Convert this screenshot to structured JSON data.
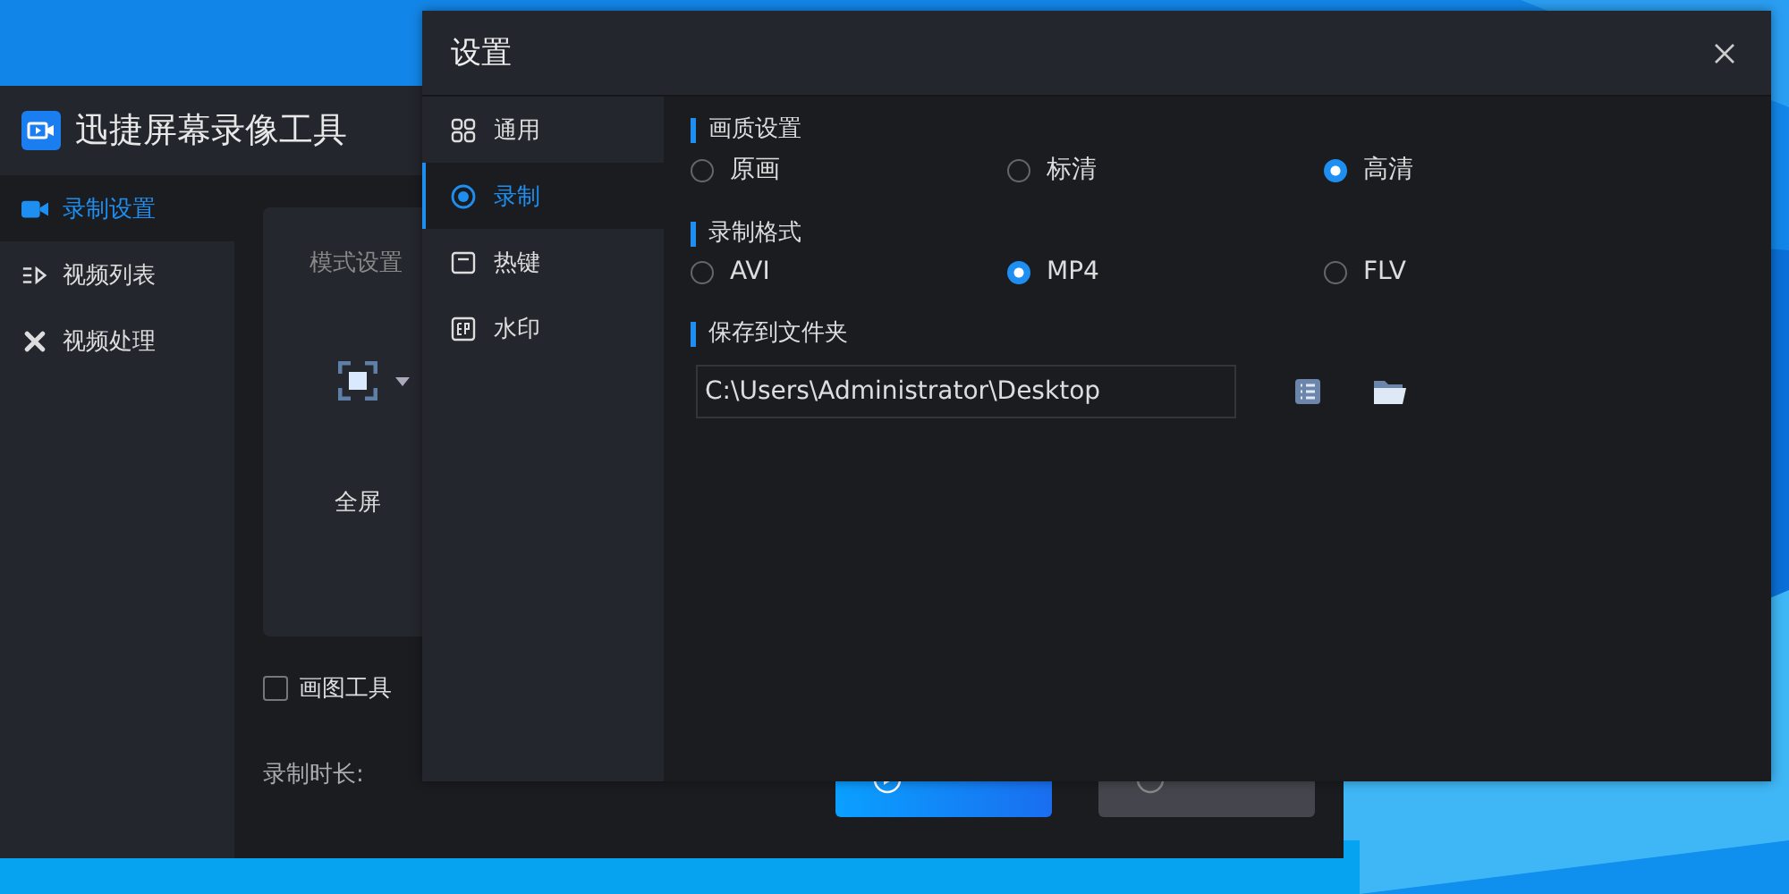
{
  "main_window": {
    "title": "迅捷屏幕录像工具",
    "sidebar": [
      {
        "label": "录制设置",
        "selected": true
      },
      {
        "label": "视频列表",
        "selected": false
      },
      {
        "label": "视频处理",
        "selected": false
      }
    ],
    "mode_card": {
      "title": "模式设置",
      "mode": "全屏"
    },
    "drawing_tool": {
      "label": "画图工具",
      "checked": false
    },
    "duration": {
      "label": "录制时长:"
    },
    "buttons": [
      {
        "kind": "primary"
      },
      {
        "kind": "disabled"
      }
    ]
  },
  "dialog": {
    "title": "设置",
    "nav": [
      {
        "label": "通用",
        "selected": false
      },
      {
        "label": "录制",
        "selected": true
      },
      {
        "label": "热键",
        "selected": false
      },
      {
        "label": "水印",
        "selected": false
      }
    ],
    "sections": [
      {
        "title": "画质设置",
        "kind": "radio",
        "options": [
          {
            "label": "原画",
            "selected": false
          },
          {
            "label": "标清",
            "selected": false
          },
          {
            "label": "高清",
            "selected": true
          }
        ]
      },
      {
        "title": "录制格式",
        "kind": "radio",
        "options": [
          {
            "label": "AVI",
            "selected": false
          },
          {
            "label": "MP4",
            "selected": true
          },
          {
            "label": "FLV",
            "selected": false
          }
        ]
      },
      {
        "title": "保存到文件夹",
        "kind": "path",
        "value": "C:\\Users\\Administrator\\Desktop"
      }
    ]
  }
}
